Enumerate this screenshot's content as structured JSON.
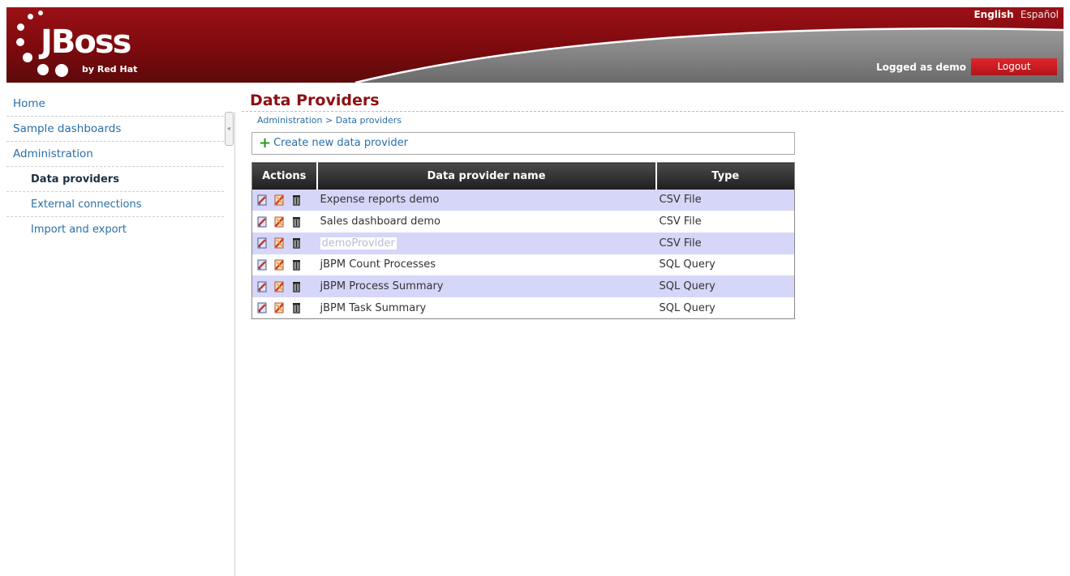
{
  "header": {
    "logo_text": "JBoss",
    "logo_sub": "by Red Hat",
    "languages": [
      {
        "label": "English",
        "active": true
      },
      {
        "label": "Español",
        "active": false
      }
    ],
    "logged_as": "Logged as demo",
    "logout_label": "Logout",
    "colors": {
      "primary": "#8c1014",
      "accent": "#e0262b"
    }
  },
  "sidebar": {
    "items": [
      {
        "label": "Home",
        "level": 1,
        "active": false
      },
      {
        "label": "Sample dashboards",
        "level": 1,
        "active": false
      },
      {
        "label": "Administration",
        "level": 1,
        "active": false
      },
      {
        "label": "Data providers",
        "level": 2,
        "active": true
      },
      {
        "label": "External connections",
        "level": 2,
        "active": false
      },
      {
        "label": "Import and export",
        "level": 2,
        "active": false
      }
    ]
  },
  "main": {
    "title": "Data Providers",
    "breadcrumb": "Administration > Data providers",
    "create_label": "Create new data provider",
    "table": {
      "headers": [
        "Actions",
        "Data provider name",
        "Type"
      ],
      "rows": [
        {
          "name": "Expense reports demo",
          "type": "CSV File"
        },
        {
          "name": "Sales dashboard demo",
          "type": "CSV File"
        },
        {
          "name": "demoProvider",
          "type": "CSV File"
        },
        {
          "name": "jBPM Count Processes",
          "type": "SQL Query"
        },
        {
          "name": "jBPM Process Summary",
          "type": "SQL Query"
        },
        {
          "name": "jBPM Task Summary",
          "type": "SQL Query"
        }
      ]
    },
    "row_actions": [
      "edit-icon",
      "delete-icon",
      "trash-icon"
    ]
  }
}
